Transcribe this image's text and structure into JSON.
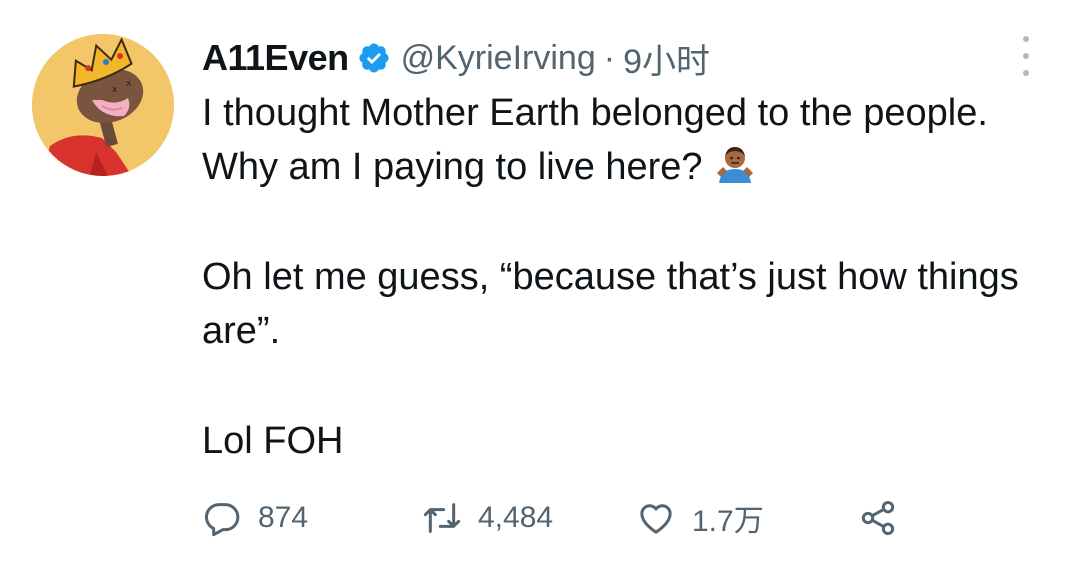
{
  "tweet": {
    "display_name": "A11Even",
    "handle": "@KyrieIrving",
    "separator": "·",
    "time": "9小时",
    "verified": true,
    "avatar_icon": "crowned-character-avatar",
    "paragraphs": [
      "I thought Mother Earth belonged to the people. Why am I paying to live here?",
      "Oh let me guess, “because that’s just how things are”.",
      "Lol FOH"
    ],
    "emoji": "person-shrugging-emoji"
  },
  "actions": {
    "reply_count": "874",
    "retweet_count": "4,484",
    "like_count": "1.7万"
  },
  "colors": {
    "text": "#0f1419",
    "secondary": "#536471",
    "verified_blue": "#1d9bf0",
    "avatar_bg": "#f3c66a"
  }
}
